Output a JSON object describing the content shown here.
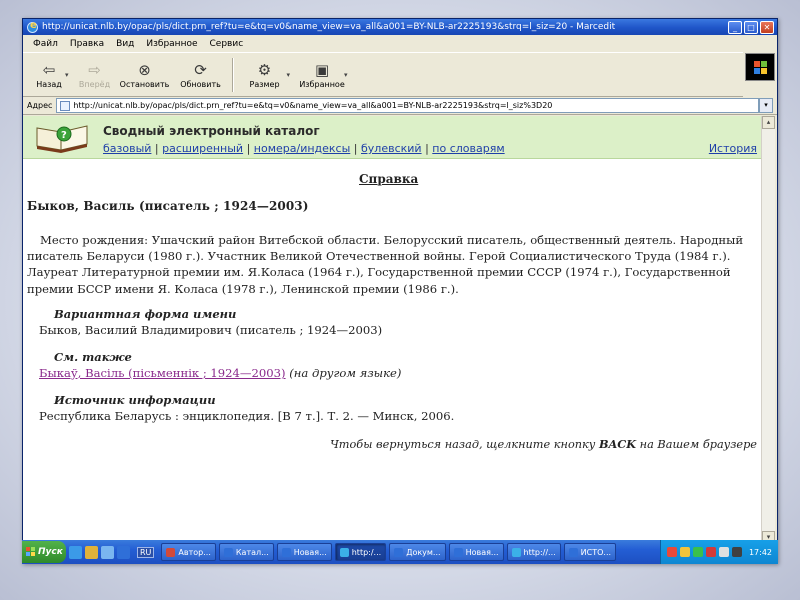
{
  "window": {
    "title": "http://unicat.nlb.by/opac/pls/dict.prn_ref?tu=e&tq=v0&name_view=va_all&a001=BY-NLB-ar2225193&strq=l_siz=20 - Marcedit"
  },
  "menu": [
    "Файл",
    "Правка",
    "Вид",
    "Избранное",
    "Сервис"
  ],
  "toolbar": {
    "back": "Назад",
    "forward": "Вперёд",
    "stop": "Остановить",
    "refresh": "Обновить",
    "size": "Размер",
    "favorites": "Избранное"
  },
  "address": {
    "label": "Адрес",
    "url": "http://unicat.nlb.by/opac/pls/dict.prn_ref?tu=e&tq=v0&name_view=va_all&a001=BY-NLB-ar2225193&strq=l_siz%3D20"
  },
  "site": {
    "title": "Сводный электронный каталог",
    "nav": [
      "базовый",
      "расширенный",
      "номера/индексы",
      "булевский",
      "по словарям"
    ],
    "history": "История"
  },
  "doc": {
    "title": "Справка",
    "heading": "Быков, Василь (писатель ; 1924—2003)",
    "paragraph": "Место рождения: Ушачский район Витебской области. Белорусский писатель, общественный деятель. Народный писатель Беларуси (1980 г.). Участник Великой Отечественной войны. Герой Социалистического Труда (1984 г.). Лауреат Литературной премии им. Я.Коласа (1964 г.), Государственной премии СССР (1974 г.), Государственной премии БССР имени Я. Коласа (1978 г.), Ленинской премии (1986 г.).",
    "variant_label": "Вариантная форма имени",
    "variant_text": "Быков, Василий Владимирович (писатель ; 1924—2003)",
    "see_also_label": "См. также",
    "see_also_link": "Быкаў, Васіль (пісьменнік ; 1924—2003)",
    "see_also_note": "(на другом языке)",
    "source_label": "Источник информации",
    "source_text": "Республика Беларусь : энциклопедия. [В 7 т.]. Т. 2. — Минск, 2006.",
    "back_note_pre": "Чтобы вернуться назад, щелкните кнопку ",
    "back_note_key": "BACK",
    "back_note_post": " на Вашем браузере"
  },
  "taskbar": {
    "start": "Пуск",
    "lang": "RU",
    "tasks": [
      "Автор...",
      "Катал...",
      "Новая...",
      "http:/...",
      "Докум...",
      "Новая...",
      "http://...",
      "ИСТО..."
    ],
    "clock": "17:42"
  },
  "colors": {
    "header_bg": "#dcf0c8",
    "link": "#1f3fa8",
    "visited_link": "#8a2a8c",
    "titlebar": "#1f55c8"
  }
}
